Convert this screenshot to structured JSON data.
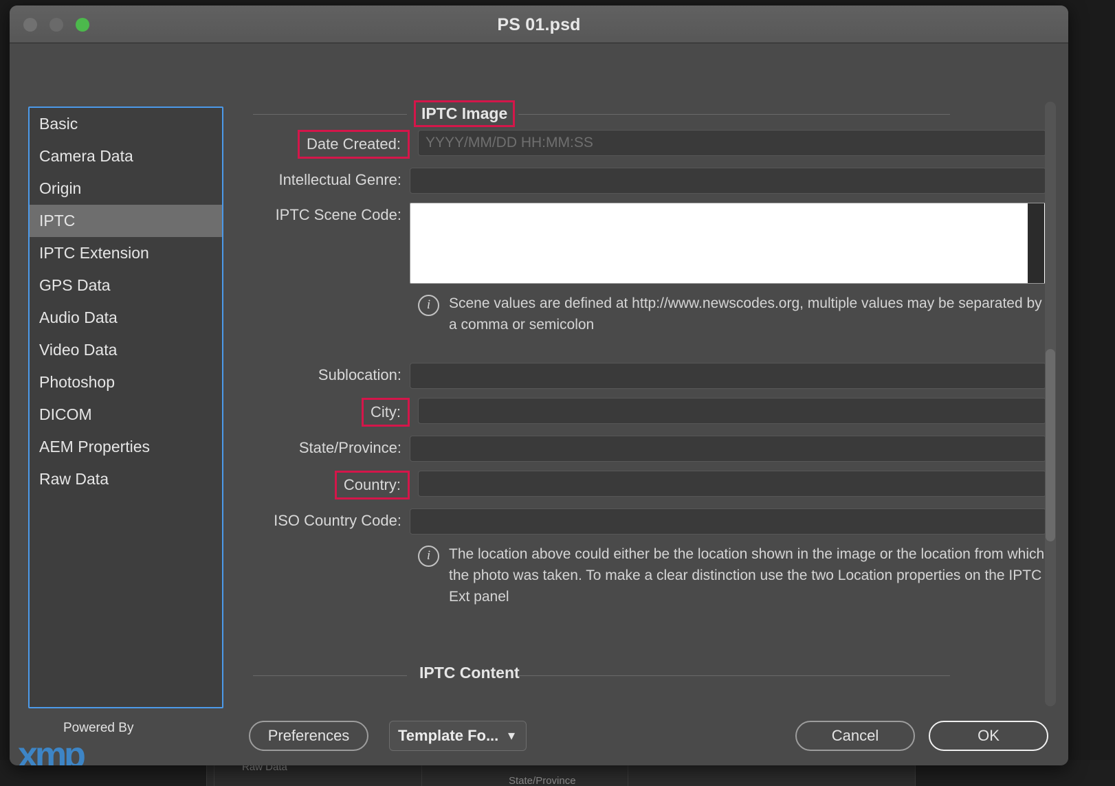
{
  "window": {
    "title": "PS 01.psd",
    "traffic_lights": [
      "close-button",
      "minimize-button",
      "zoom-button"
    ]
  },
  "sidebar": {
    "items": [
      {
        "label": "Basic",
        "selected": false
      },
      {
        "label": "Camera Data",
        "selected": false
      },
      {
        "label": "Origin",
        "selected": false
      },
      {
        "label": "IPTC",
        "selected": true
      },
      {
        "label": "IPTC Extension",
        "selected": false
      },
      {
        "label": "GPS Data",
        "selected": false
      },
      {
        "label": "Audio Data",
        "selected": false
      },
      {
        "label": "Video Data",
        "selected": false
      },
      {
        "label": "Photoshop",
        "selected": false
      },
      {
        "label": "DICOM",
        "selected": false
      },
      {
        "label": "AEM Properties",
        "selected": false
      },
      {
        "label": "Raw Data",
        "selected": false
      }
    ]
  },
  "branding": {
    "powered_by": "Powered By",
    "logo_text": "xmp",
    "logo_color": "#3d85c6"
  },
  "panel": {
    "section_image": {
      "title": "IPTC Image",
      "title_highlighted": true
    },
    "fields": {
      "date_created": {
        "label": "Date Created:",
        "highlighted": true,
        "value": "",
        "placeholder": "YYYY/MM/DD HH:MM:SS"
      },
      "intellectual_genre": {
        "label": "Intellectual Genre:",
        "highlighted": false,
        "value": ""
      },
      "iptc_scene_code": {
        "label": "IPTC Scene Code:",
        "highlighted": false,
        "value": ""
      },
      "sublocation": {
        "label": "Sublocation:",
        "highlighted": false,
        "value": ""
      },
      "city": {
        "label": "City:",
        "highlighted": true,
        "value": ""
      },
      "state_province": {
        "label": "State/Province:",
        "highlighted": false,
        "value": ""
      },
      "country": {
        "label": "Country:",
        "highlighted": true,
        "value": ""
      },
      "iso_country_code": {
        "label": "ISO Country Code:",
        "highlighted": false,
        "value": ""
      }
    },
    "notes": {
      "scene": "Scene values are defined at http://www.newscodes.org, multiple values may be separated by a comma or semicolon",
      "location": "The location above could either be the location shown in the image or the location from which the photo was taken. To make a clear distinction use the two Location properties on the IPTC Ext panel"
    },
    "section_content": {
      "title": "IPTC Content"
    }
  },
  "bottombar": {
    "preferences_label": "Preferences",
    "template_label": "Template Fo...",
    "template_chevron": "chevron-down-icon",
    "cancel_label": "Cancel",
    "ok_label": "OK"
  },
  "background_window": {
    "text_left": "Raw Data",
    "text_right": "State/Province"
  },
  "colors": {
    "highlight": "#d4164a",
    "sidebar_focus": "#4c9aea",
    "window_bg": "#4a4a4a"
  }
}
